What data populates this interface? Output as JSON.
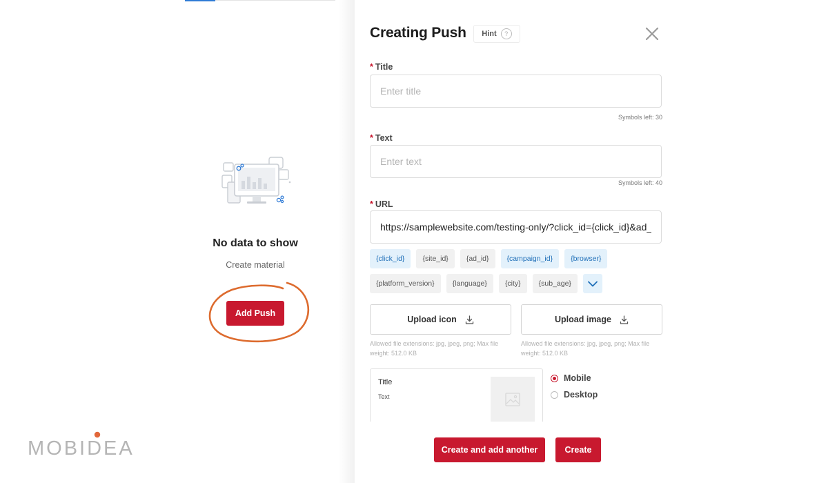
{
  "left": {
    "empty_title": "No data to show",
    "empty_subtitle": "Create material",
    "add_push_label": "Add Push"
  },
  "brand": {
    "logo_text": "MOBIDEA",
    "logo_color": "#b5b5b5",
    "logo_dot_color": "#e2673a"
  },
  "drawer": {
    "title": "Creating Push",
    "hint_label": "Hint",
    "hint_icon": "question-circle-icon",
    "close_icon": "close-icon"
  },
  "form": {
    "title": {
      "label": "Title",
      "placeholder": "Enter title",
      "value": "",
      "symbols_left": "Symbols left: 30"
    },
    "text": {
      "label": "Text",
      "placeholder": "Enter text",
      "value": "",
      "symbols_left": "Symbols left: 40"
    },
    "url": {
      "label": "URL",
      "value": "https://samplewebsite.com/testing-only/?click_id={click_id}&ad_id={ad_id}"
    },
    "required_mark": "*",
    "tags_row1": [
      {
        "label": "{click_id}",
        "active": true
      },
      {
        "label": "{site_id}",
        "active": false
      },
      {
        "label": "{ad_id}",
        "active": false
      },
      {
        "label": "{campaign_id}",
        "active": true
      },
      {
        "label": "{browser}",
        "active": true
      }
    ],
    "tags_row2": [
      {
        "label": "{platform_version}",
        "active": false
      },
      {
        "label": "{language}",
        "active": false
      },
      {
        "label": "{city}",
        "active": false
      },
      {
        "label": "{sub_age}",
        "active": false
      }
    ],
    "upload_icon": {
      "label": "Upload icon",
      "note": "Allowed file extensions: jpg, jpeg, png; Max file weight: 512.0 KB"
    },
    "upload_image": {
      "label": "Upload image",
      "note": "Allowed file extensions: jpg, jpeg, png; Max file weight: 512.0 KB"
    },
    "preview": {
      "title": "Title",
      "text": "Text"
    },
    "device_options": [
      {
        "label": "Mobile",
        "selected": true
      },
      {
        "label": "Desktop",
        "selected": false
      }
    ]
  },
  "footer": {
    "create_and_add_label": "Create and add another",
    "create_label": "Create"
  },
  "colors": {
    "accent_red": "#c8192f",
    "tag_blue_bg": "#e3f1fb",
    "tag_blue_text": "#1f6fb8",
    "annotation_orange": "#dd6b2e"
  }
}
